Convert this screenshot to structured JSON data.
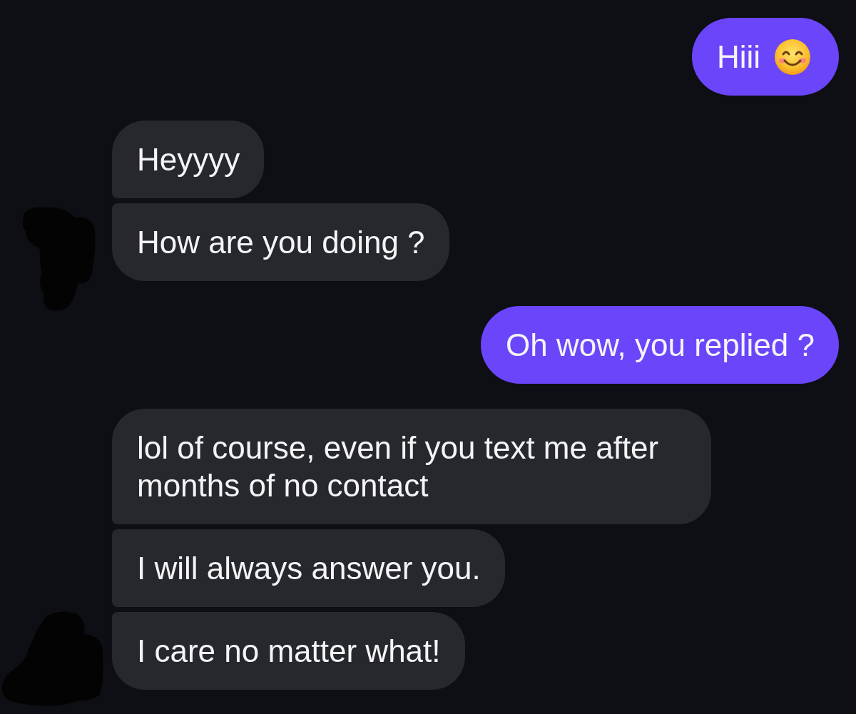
{
  "messages": [
    {
      "kind": "outgoing",
      "text": "Hiii",
      "trailing_emoji": true
    },
    {
      "kind": "incoming",
      "text": "Heyyyy"
    },
    {
      "kind": "incoming",
      "text": "How are you doing ?"
    },
    {
      "kind": "outgoing",
      "text": "Oh wow, you replied ?"
    },
    {
      "kind": "incoming",
      "text": "lol of course, even if you text me after months of no contact"
    },
    {
      "kind": "incoming",
      "text": "I will always answer you."
    },
    {
      "kind": "incoming",
      "text": "I care no matter what!"
    }
  ]
}
